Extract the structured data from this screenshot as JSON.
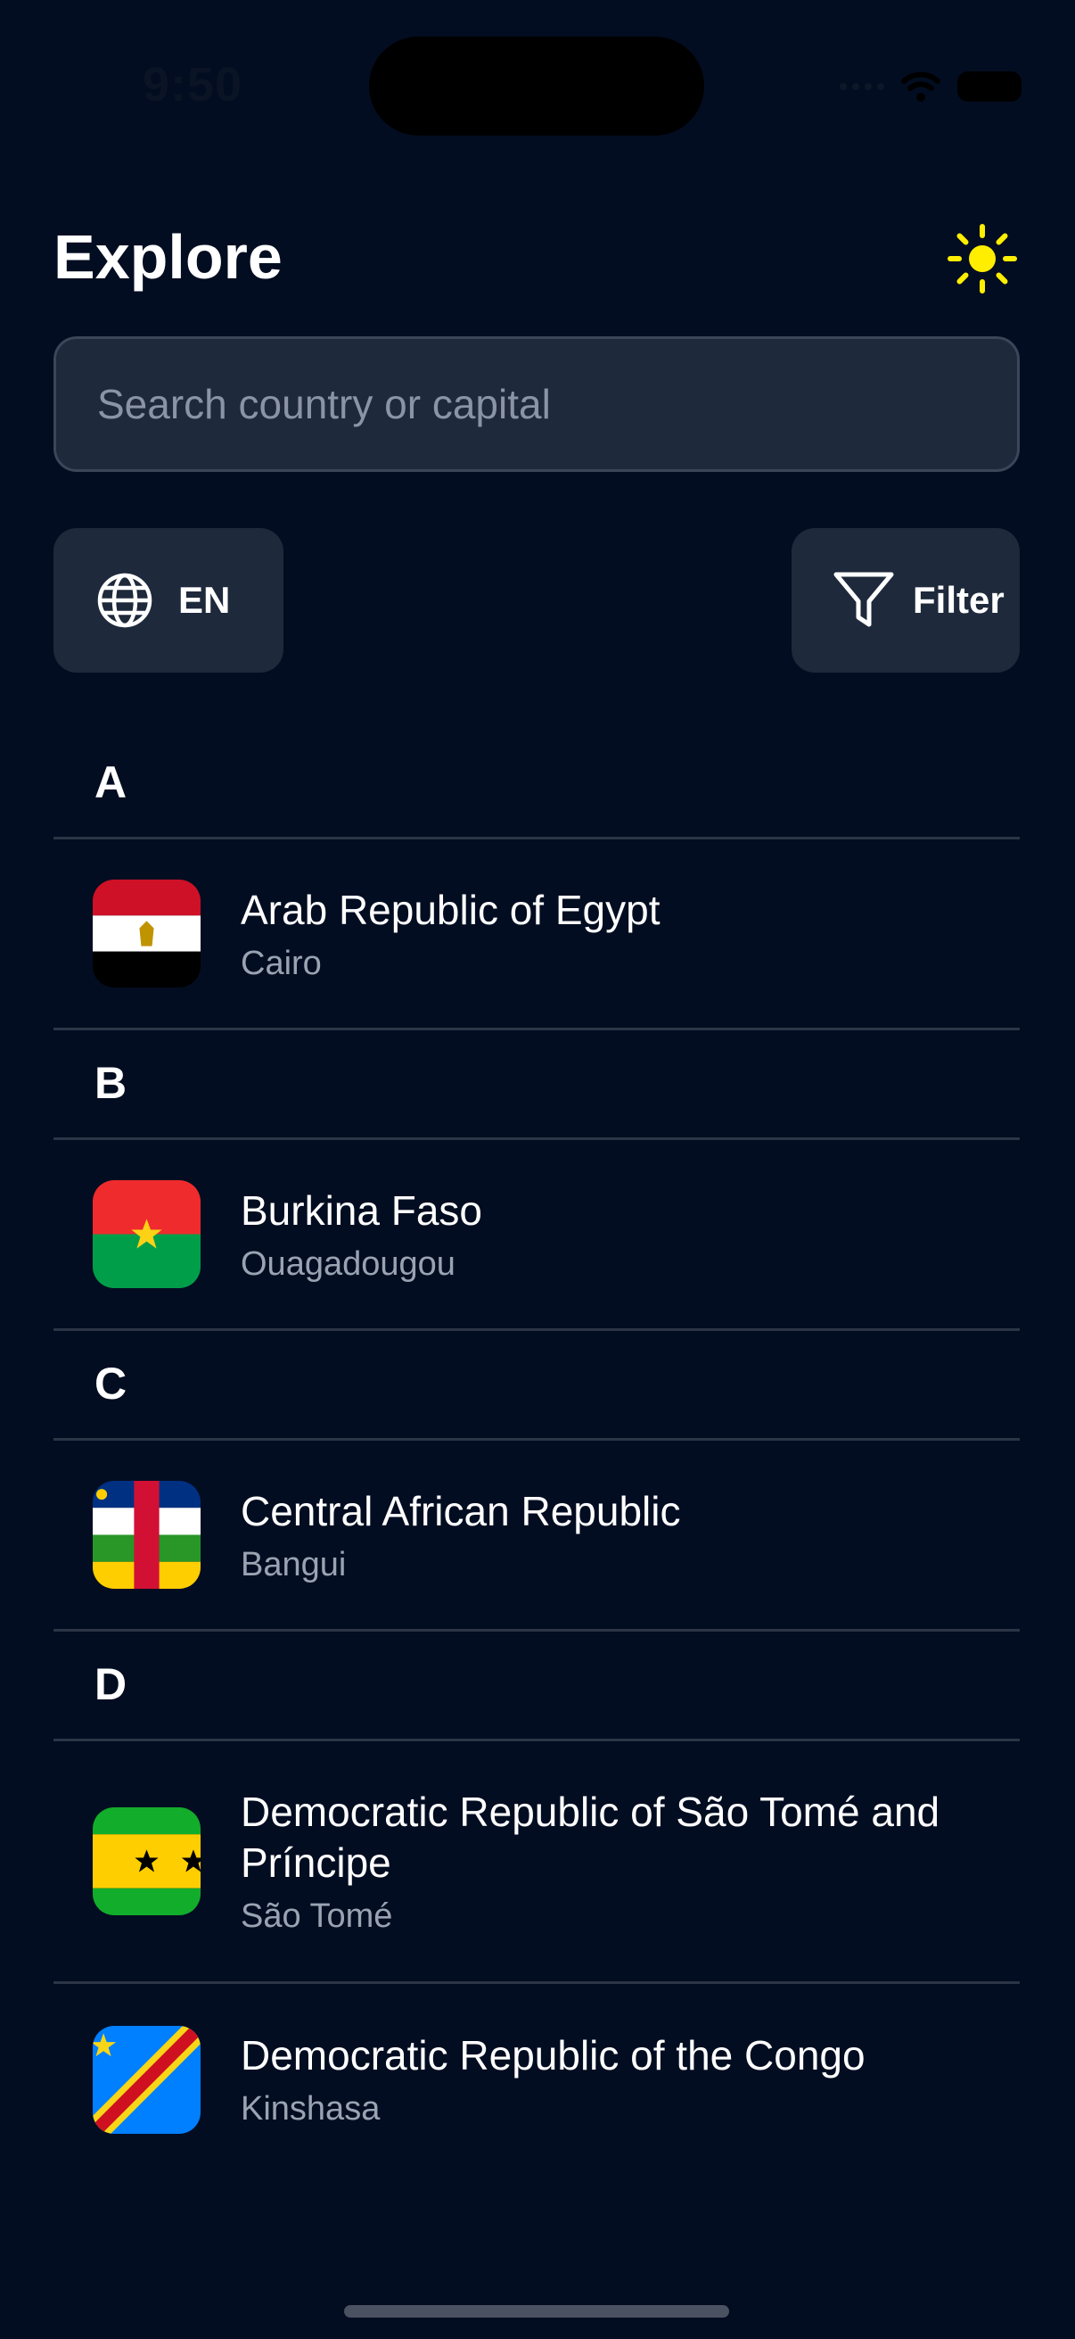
{
  "status_bar": {
    "time": "9:50"
  },
  "header": {
    "title": "Explore",
    "theme_icon": "sun-icon"
  },
  "search": {
    "placeholder": "Search country or capital",
    "value": ""
  },
  "language_button": {
    "label": "EN",
    "icon": "globe-icon"
  },
  "filter_button": {
    "label": "Filter",
    "icon": "filter-icon"
  },
  "sections": [
    {
      "letter": "A",
      "rows": [
        {
          "name": "Arab Republic of Egypt",
          "capital": "Cairo",
          "flag": "egypt-flag"
        }
      ]
    },
    {
      "letter": "B",
      "rows": [
        {
          "name": "Burkina Faso",
          "capital": "Ouagadougou",
          "flag": "burkina-faso-flag"
        }
      ]
    },
    {
      "letter": "C",
      "rows": [
        {
          "name": "Central African Republic",
          "capital": "Bangui",
          "flag": "central-african-republic-flag"
        }
      ]
    },
    {
      "letter": "D",
      "rows": [
        {
          "name": "Democratic Republic of São Tomé and Príncipe",
          "capital": "São Tomé",
          "flag": "sao-tome-flag"
        },
        {
          "name": "Democratic Republic of the Congo",
          "capital": "Kinshasa",
          "flag": "dr-congo-flag"
        }
      ]
    }
  ],
  "colors": {
    "background": "#030d21",
    "surface": "#1e293b",
    "accent_sun": "#ffee00",
    "secondary_text": "#9aa3b2"
  }
}
